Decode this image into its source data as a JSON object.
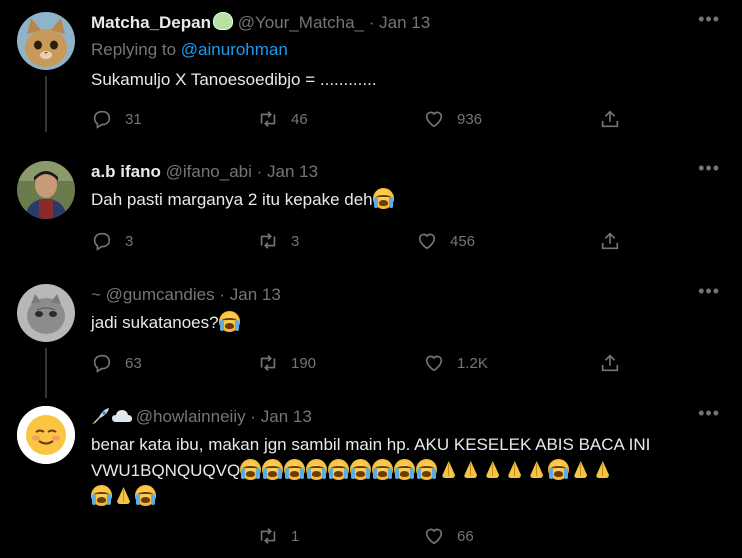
{
  "tweets": [
    {
      "name": "Matcha_Depan",
      "handle": "@Your_Matcha_",
      "time": "Jan 13",
      "replying_prefix": "Replying to",
      "replying_to": "@ainurohman",
      "text": "Sukamuljo X Tanoesoedibjo = ............",
      "replies": "31",
      "retweets": "46",
      "likes": "936"
    },
    {
      "name": "a.b ifano",
      "handle": "@ifano_abi",
      "time": "Jan 13",
      "text": "Dah pasti marganya 2 itu kepake deh",
      "replies": "3",
      "retweets": "3",
      "likes": "456"
    },
    {
      "name": "~",
      "handle": "@gumcandies",
      "time": "Jan 13",
      "text": "jadi sukatanoes?",
      "replies": "63",
      "retweets": "190",
      "likes": "1.2K"
    },
    {
      "name": "",
      "handle": "@howlainneiiy",
      "time": "Jan 13",
      "text_line1": "benar kata ibu, makan jgn sambil main hp. AKU KESELEK ABIS BACA INI",
      "text_line2": "VWU1BQNQUQVQ",
      "replies": "",
      "retweets": "1",
      "likes": "66"
    }
  ],
  "separator": "·",
  "icons": [
    "reply-icon",
    "retweet-icon",
    "like-icon",
    "share-icon",
    "more-icon",
    "loudly-crying-face-emoji",
    "folded-hands-emoji",
    "rocket-emoji",
    "cloud-emoji"
  ],
  "colors": {
    "background": "#000000",
    "text": "#e7e9ea",
    "muted": "#71767b",
    "link": "#1d9bf0"
  }
}
